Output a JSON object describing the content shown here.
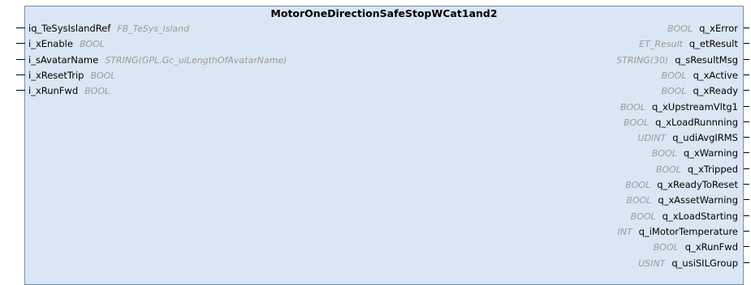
{
  "block": {
    "title": "MotorOneDirectionSafeStopWCat1and2",
    "inputs": [
      {
        "name": "iq_TeSysIslandRef",
        "type": "FB_TeSys_island"
      },
      {
        "name": "i_xEnable",
        "type": "BOOL"
      },
      {
        "name": "i_sAvatarName",
        "type": "STRING(GPL.Gc_uiLengthOfAvatarName)"
      },
      {
        "name": "i_xResetTrip",
        "type": "BOOL"
      },
      {
        "name": "i_xRunFwd",
        "type": "BOOL"
      }
    ],
    "outputs": [
      {
        "name": "q_xError",
        "type": "BOOL"
      },
      {
        "name": "q_etResult",
        "type": "ET_Result"
      },
      {
        "name": "q_sResultMsg",
        "type": "STRING(30)"
      },
      {
        "name": "q_xActive",
        "type": "BOOL"
      },
      {
        "name": "q_xReady",
        "type": "BOOL"
      },
      {
        "name": "q_xUpstreamVltg1",
        "type": "BOOL"
      },
      {
        "name": "q_xLoadRunnning",
        "type": "BOOL"
      },
      {
        "name": "q_udiAvgIRMS",
        "type": "UDINT"
      },
      {
        "name": "q_xWarning",
        "type": "BOOL"
      },
      {
        "name": "q_xTripped",
        "type": "BOOL"
      },
      {
        "name": "q_xReadyToReset",
        "type": "BOOL"
      },
      {
        "name": "q_xAssetWarning",
        "type": "BOOL"
      },
      {
        "name": "q_xLoadStarting",
        "type": "BOOL"
      },
      {
        "name": "q_iMotorTemperature",
        "type": "INT"
      },
      {
        "name": "q_xRunFwd",
        "type": "BOOL"
      },
      {
        "name": "q_usiSILGroup",
        "type": "USINT"
      }
    ]
  }
}
